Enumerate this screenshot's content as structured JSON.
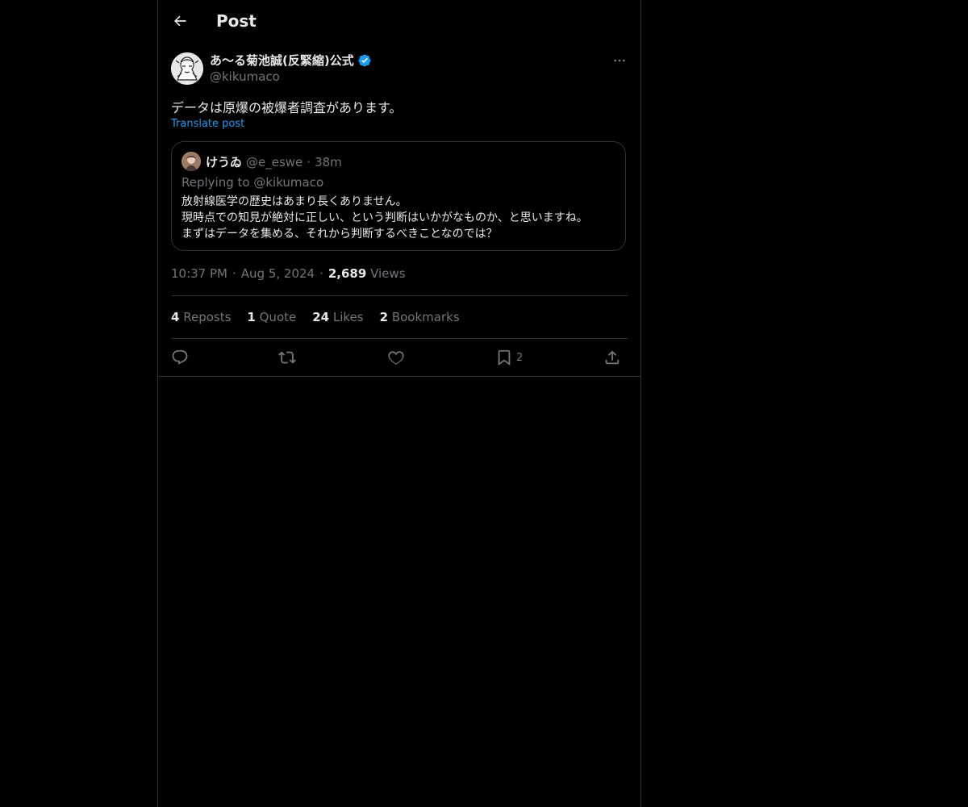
{
  "header": {
    "title": "Post"
  },
  "author": {
    "display_name": "あ〜る菊池誠(反緊縮)公式",
    "handle": "@kikumaco"
  },
  "post": {
    "text": "データは原爆の被爆者調査があります。",
    "translate_label": "Translate post",
    "time": "10:37 PM",
    "date": "Aug 5, 2024",
    "views_count": "2,689",
    "views_label": "Views"
  },
  "quote": {
    "display_name": "けうゐ",
    "handle": "@e_eswe",
    "time": "38m",
    "replying_to": "Replying to @kikumaco",
    "lines": [
      "放射線医学の歴史はあまり長くありません。",
      "現時点での知見が絶対に正しい、という判断はいかがなものか、と思いますね。",
      "まずはデータを集める、それから判断するべきことなのでは？"
    ]
  },
  "stats": {
    "reposts_count": "4",
    "reposts_label": "Reposts",
    "quote_count": "1",
    "quote_label": "Quote",
    "likes_count": "24",
    "likes_label": "Likes",
    "bookmarks_count": "2",
    "bookmarks_label": "Bookmarks"
  },
  "actions": {
    "bookmark_count": "2"
  },
  "colors": {
    "accent": "#1d9bf0",
    "muted": "#71767b",
    "text": "#e7e9ea",
    "border": "#2f3336"
  }
}
